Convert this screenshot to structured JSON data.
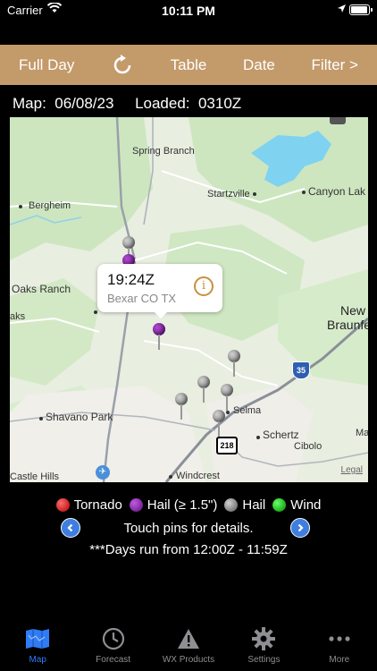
{
  "status": {
    "carrier": "Carrier",
    "time": "10:11 PM"
  },
  "toolbar": {
    "full_day": "Full Day",
    "table": "Table",
    "date": "Date",
    "filter": "Filter >"
  },
  "info": {
    "map_label": "Map:",
    "map_date": "06/08/23",
    "loaded_label": "Loaded:",
    "loaded_time": "0310Z"
  },
  "map": {
    "places": {
      "spring_branch": "Spring Branch",
      "startzville": "Startzville",
      "canyon_lake": "Canyon Lak",
      "bergheim": "Bergheim",
      "oaks_ranch": "Oaks Ranch",
      "aks": "aks",
      "new_braunfels_1": "New",
      "new_braunfels_2": "Braunfe",
      "shavano_park": "Shavano Park",
      "selma": "Selma",
      "schertz": "Schertz",
      "cibolo": "Cibolo",
      "castle_hills": "Castle Hills",
      "windcrest": "Windcrest",
      "ma": "Ma"
    },
    "shields": {
      "i35": "35",
      "r218": "218"
    },
    "legal": "Legal",
    "callout": {
      "time": "19:24Z",
      "location": "Bexar CO TX"
    }
  },
  "legend": [
    {
      "label": "Tornado",
      "color": "red"
    },
    {
      "label": "Hail (≥ 1.5\")",
      "color": "purple"
    },
    {
      "label": "Hail",
      "color": "gray"
    },
    {
      "label": "Wind",
      "color": "green"
    }
  ],
  "hint": "Touch pins for details.",
  "days_note": "***Days run from 12:00Z - 11:59Z",
  "tabs": [
    {
      "label": "Map",
      "icon": "map-icon",
      "active": true
    },
    {
      "label": "Forecast",
      "icon": "clock-icon",
      "active": false
    },
    {
      "label": "WX Products",
      "icon": "warning-icon",
      "active": false
    },
    {
      "label": "Settings",
      "icon": "gear-icon",
      "active": false
    },
    {
      "label": "More",
      "icon": "more-icon",
      "active": false
    }
  ],
  "colors": {
    "toolbar": "#c39a6a",
    "accent": "#2f7cf6",
    "water": "#7fd3f0"
  }
}
